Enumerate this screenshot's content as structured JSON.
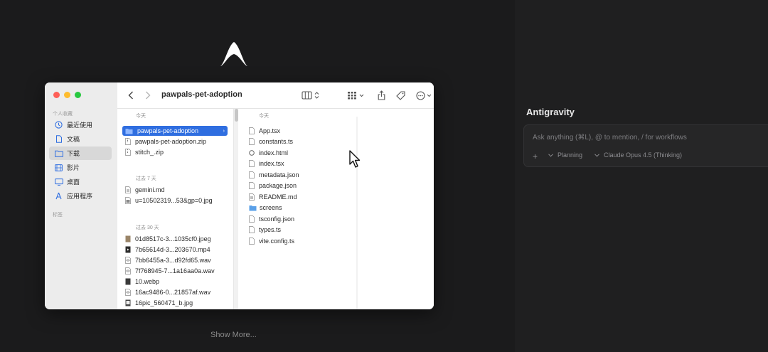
{
  "logo": {
    "icon": "antigravity-logo"
  },
  "finder": {
    "path_title": "pawpals-pet-adoption",
    "sidebar": {
      "favorites_label": "个人收藏",
      "tags_label": "标签",
      "items": [
        {
          "label": "最近使用",
          "icon": "clock-icon"
        },
        {
          "label": "文稿",
          "icon": "document-icon"
        },
        {
          "label": "下载",
          "icon": "downloads-folder-icon",
          "selected": true
        },
        {
          "label": "影片",
          "icon": "film-icon"
        },
        {
          "label": "桌面",
          "icon": "desktop-icon"
        },
        {
          "label": "应用程序",
          "icon": "applications-icon"
        }
      ]
    },
    "column1": {
      "groups": [
        {
          "label": "今天",
          "files": [
            "pawpals-pet-adoption",
            "pawpals-pet-adoption.zip",
            "stitch_.zip"
          ]
        },
        {
          "label": "过去 7 天",
          "files": [
            "gemini.md",
            "u=10502319...53&gp=0.jpg"
          ]
        },
        {
          "label": "过去 30 天",
          "files": [
            "01d8517c-3...1035cf0.jpeg",
            "7b65614d-3...203670.mp4",
            "7bb6455a-3...d92fd65.wav",
            "7f768945-7...1a16aa0a.wav",
            "10.webp",
            "16ac9486-0...21857af.wav",
            "16pic_560471_b.jpg"
          ]
        }
      ]
    },
    "column2": {
      "group_label": "今天",
      "files": [
        "App.tsx",
        "constants.ts",
        "index.html",
        "index.tsx",
        "metadata.json",
        "package.json",
        "README.md",
        "screens",
        "tsconfig.json",
        "types.ts",
        "vite.config.ts"
      ]
    }
  },
  "show_more": "Show More...",
  "agent": {
    "title": "Antigravity",
    "input_placeholder": "Ask anything (⌘L), @ to mention, / for workflows",
    "add_icon": "+",
    "mode_label": "Planning",
    "model_label": "Claude Opus 4.5 (Thinking)"
  }
}
